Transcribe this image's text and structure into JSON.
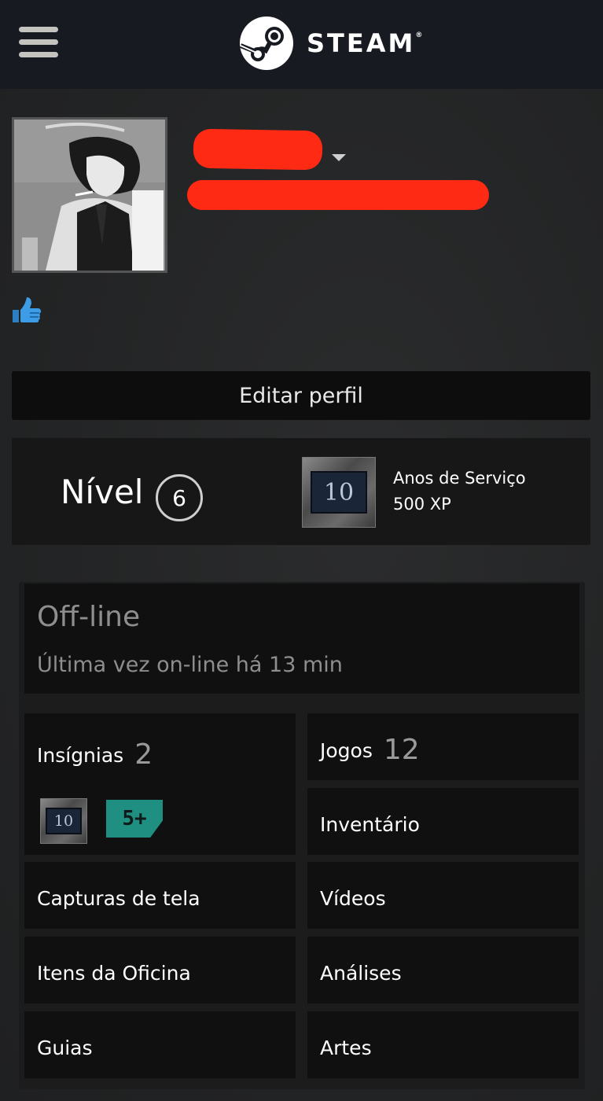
{
  "header": {
    "brand": "STEAM",
    "trademark": "®"
  },
  "profile": {
    "edit_label": "Editar perfil"
  },
  "level": {
    "label": "Nível",
    "value": "6",
    "badge_number": "10",
    "badge_title": "Anos de Serviço",
    "badge_xp": "500 XP"
  },
  "status": {
    "title": "Off-line",
    "last_online": "Última vez on-line há 13 min"
  },
  "tiles": {
    "badges": {
      "label": "Insígnias",
      "count": "2",
      "badge1_text": "10",
      "badge2_text": "5+"
    },
    "games": {
      "label": "Jogos",
      "count": "12"
    },
    "inventory": {
      "label": "Inventário"
    },
    "screenshots": {
      "label": "Capturas de tela"
    },
    "videos": {
      "label": "Vídeos"
    },
    "workshop": {
      "label": "Itens da Oficina"
    },
    "reviews": {
      "label": "Análises"
    },
    "guides": {
      "label": "Guias"
    },
    "artwork": {
      "label": "Artes"
    }
  },
  "colors": {
    "topbar": "#171a21",
    "background": "#242526",
    "panel": "#101010",
    "redaction": "#ff2a14",
    "thumb": "#3c9de6"
  }
}
